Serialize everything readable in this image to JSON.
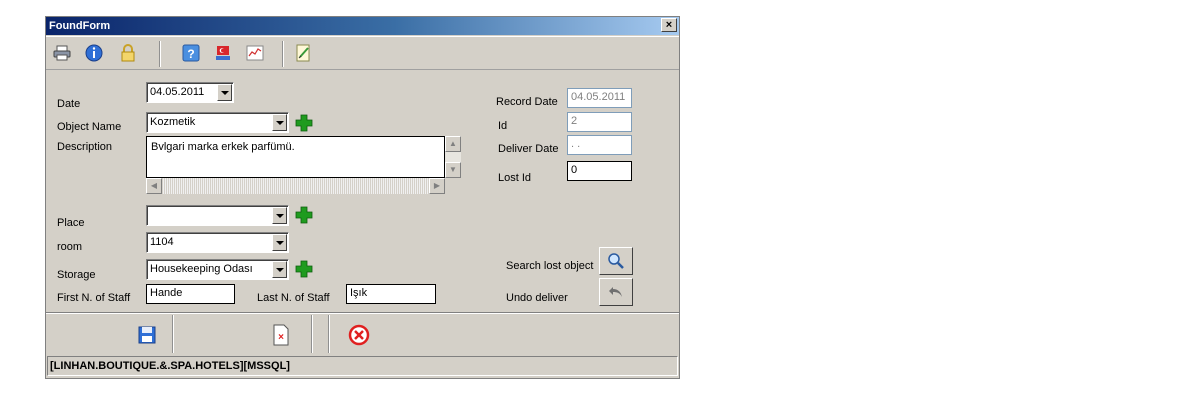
{
  "window": {
    "title": "FoundForm",
    "close_glyph": "×"
  },
  "toolbar": {
    "icons": [
      "printer-icon",
      "info-icon",
      "lock-icon",
      "help-icon",
      "flag-icon",
      "chart-icon",
      "edit-icon"
    ]
  },
  "form": {
    "date_label": "Date",
    "date_value": "04.05.2011",
    "object_name_label": "Object Name",
    "object_name_value": "Kozmetik",
    "description_label": "Description",
    "description_value": "Bvlgari marka erkek parfümü.",
    "place_label": "Place",
    "place_value": "",
    "room_label": "room",
    "room_value": "1104",
    "storage_label": "Storage",
    "storage_value": "Housekeeping Odası",
    "first_staff_label": "First N. of Staff",
    "first_staff_value": "Hande",
    "last_staff_label": "Last N. of Staff",
    "last_staff_value": "Işık",
    "record_date_label": "Record Date",
    "record_date_value": "04.05.2011",
    "id_label": "Id",
    "id_value": "2",
    "deliver_date_label": "Deliver Date",
    "deliver_date_value": "  .  .",
    "lost_id_label": "Lost Id",
    "lost_id_value": "0",
    "search_lost_label": "Search lost object",
    "undo_deliver_label": "Undo deliver"
  },
  "status": {
    "text": "[LINHAN.BOUTIQUE.&.SPA.HOTELS][MSSQL]"
  },
  "colors": {
    "title_start": "#0a246a",
    "title_end": "#a6caf0",
    "face": "#d4d0c8",
    "plus_green": "#1f9b1f",
    "cancel_red": "#e02020"
  }
}
